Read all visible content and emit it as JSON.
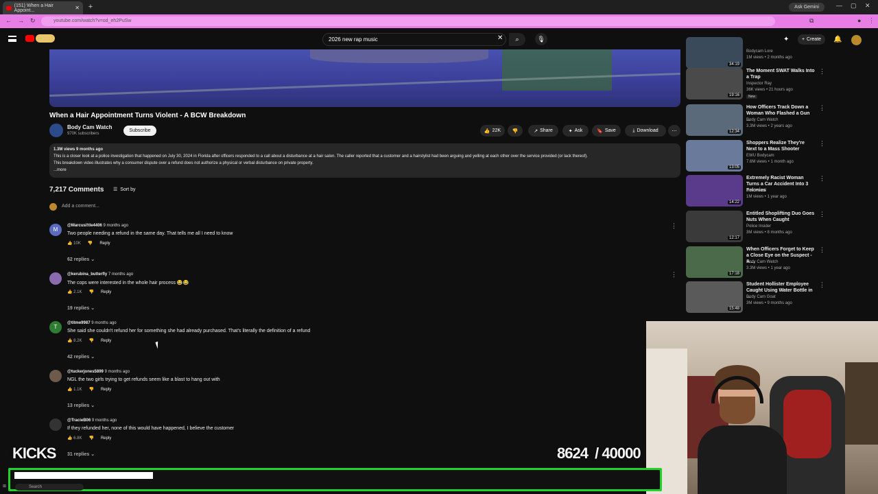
{
  "browser": {
    "tab_title": "(151) When a Hair Appoint...",
    "ask_gemini": "Ask Gemini",
    "url": "youtube.com/watch?v=od_eh2PuSw"
  },
  "header": {
    "search_query": "2026 new rap music",
    "create_label": "Create"
  },
  "video": {
    "title": "When a Hair Appointment Turns Violent - A BCW Breakdown",
    "channel": "Body Cam Watch",
    "subscribers": "970K subscribers",
    "subscribe_label": "Subscribe",
    "likes": "22K",
    "share_label": "Share",
    "ask_label": "Ask",
    "save_label": "Save",
    "download_label": "Download",
    "views_age": "1.3M views  9 months ago",
    "description_line1": "This is a closer look at a police investigation that happened on July 30, 2024 in Florida after officers responded to a call about a disturbance at a hair salon. The caller reported that a customer and a hairstylist had been arguing and yelling at each other over the service provided (or lack thereof).",
    "description_line2": "This breakdown video illustrates why a consumer dispute over a refund does not authorize a physical or verbal disturbance on private property.",
    "more_label": "...more"
  },
  "comments": {
    "count_label": "7,217 Comments",
    "sort_label": "Sort by",
    "add_placeholder": "Add a comment...",
    "items": [
      {
        "initial": "M",
        "color": "#5c6bc0",
        "author": "@Marcusl!tle4406",
        "age": "9 months ago",
        "text": "Two people needing a refund in the same day. That tells me all I need to know",
        "likes": "10K",
        "reply": "Reply",
        "replies": "62 replies"
      },
      {
        "initial": "",
        "color": "#8a6bb0",
        "author": "@kerubina_butterfly",
        "age": "7 months ago",
        "text": "The cops were interested in the whole hair process 😂😂",
        "likes": "2.1K",
        "reply": "Reply",
        "replies": "19 replies"
      },
      {
        "initial": "T",
        "color": "#2e7d32",
        "author": "@titme9987",
        "age": "9 months ago",
        "text": "She said she couldn't refund her for something she had already purchased. That's literally the definition of a refund",
        "likes": "8.2K",
        "reply": "Reply",
        "replies": "42 replies"
      },
      {
        "initial": "",
        "color": "#6d5a4a",
        "author": "@tuckerjones5899",
        "age": "9 months ago",
        "text": "NGL the two girls trying to get refunds seem like a blast to hang out with",
        "likes": "1.1K",
        "reply": "Reply",
        "replies": "13 replies"
      },
      {
        "initial": "",
        "color": "#333333",
        "author": "@TracieB06",
        "age": "9 months ago",
        "text": "If they refunded her, none of this would have happened, I believe the customer",
        "likes": "6.8K",
        "reply": "Reply",
        "replies": "31 replies"
      }
    ]
  },
  "sidebar": {
    "items": [
      {
        "title": "",
        "channel": "Bodycam Lore",
        "meta": "1M views • 2 months ago",
        "duration": "34:19",
        "thumb": "#3a4a5a"
      },
      {
        "title": "The Moment SWAT Walks Into a Trap",
        "channel": "Inspector Ray",
        "meta": "36K views • 21 hours ago",
        "duration": "19:16",
        "badge": "New",
        "thumb": "#4a4a4a"
      },
      {
        "title": "How Officers Track Down a Woman Who Flashed a Gun ...",
        "channel": "Body Cam Watch",
        "meta": "3.3M views • 2 years ago",
        "duration": "12:34",
        "thumb": "#5a6a7a"
      },
      {
        "title": "Shoppers Realize They're Next to a Mass Shooter",
        "channel": "EWU Bodycam",
        "meta": "7.6M views • 1 month ago",
        "duration": "13:05",
        "thumb": "#6a7a9a"
      },
      {
        "title": "Extremely Racist Woman Turns a Car Accident Into 3 Felonies",
        "channel": "Uncovered",
        "meta": "1M views • 1 year ago",
        "duration": "14:22",
        "thumb": "#5a3a8a"
      },
      {
        "title": "Entitled Shoplifting Duo Goes Nuts When Caught",
        "channel": "Police Insider",
        "meta": "3M views • 8 months ago",
        "duration": "12:17",
        "thumb": "#3a3a3a"
      },
      {
        "title": "When Officers Forget to Keep a Close Eye on the Suspect - A ...",
        "channel": "Body Cam Watch",
        "meta": "3.3M views • 1 year ago",
        "duration": "17:18",
        "thumb": "#4a6a4a"
      },
      {
        "title": "Student Hollister Employee Caught Using Water Bottle in ...",
        "channel": "Body Cam Goat",
        "meta": "3M views • 9 months ago",
        "duration": "15:48",
        "thumb": "#5a5a5a"
      }
    ]
  },
  "overlay": {
    "kicks_label": "KICKS",
    "goal_text": "8624  / 40000",
    "goal_current": 8624,
    "goal_total": 40000
  },
  "taskbar": {
    "search_placeholder": "Search"
  }
}
